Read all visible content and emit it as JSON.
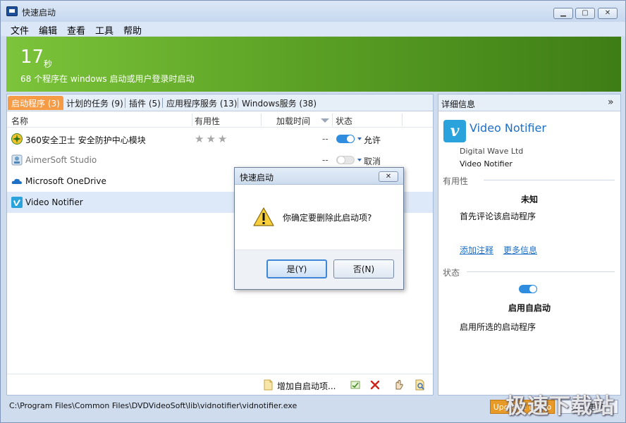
{
  "window": {
    "title": "快速启动"
  },
  "menu": [
    "文件",
    "编辑",
    "查看",
    "工具",
    "帮助"
  ],
  "banner": {
    "number": "17",
    "unit": "秒",
    "description": "68 个程序在 windows 启动或用户登录时启动"
  },
  "tabs": [
    {
      "label": "启动程序 (3)",
      "active": true
    },
    {
      "label": "计划的任务 (9)"
    },
    {
      "label": "插件 (5)"
    },
    {
      "label": "应用程序服务 (13)"
    },
    {
      "label": "Windows服务 (38)"
    }
  ],
  "columns": {
    "name": "名称",
    "usefulness": "有用性",
    "load_time": "加载时间",
    "status": "状态"
  },
  "rows": [
    {
      "name": "360安全卫士 安全防护中心模块",
      "stars": "★★★",
      "load_time": "--",
      "status": "允许",
      "enabled": true
    },
    {
      "name": "AimerSoft Studio",
      "load_time": "--",
      "status": "取消",
      "enabled": false
    },
    {
      "name": "Microsoft OneDrive"
    },
    {
      "name": "Video Notifier",
      "selected": true
    }
  ],
  "toolbar": {
    "add_label": "增加自启动项..."
  },
  "details": {
    "header": "详细信息",
    "collapse_glyph": "»",
    "logo_letter": "v",
    "app_name": "Video Notifier",
    "vendor": "Digital Wave Ltd",
    "file": "Video Notifier",
    "usefulness_section": "有用性",
    "usefulness_value": "未知",
    "rate_text": "首先评论该启动程序",
    "link_add_note": "添加注释",
    "link_more_info": "更多信息",
    "status_section": "状态",
    "status_value": "启用自启动",
    "status_desc": "启用所选的启动程序"
  },
  "statusbar": {
    "path": "C:\\Program Files\\Common Files\\DVDVideoSoft\\lib\\vidnotifier\\vidnotifier.exe",
    "upgrade": "Upgrade to Pro",
    "about": "关于更多"
  },
  "watermark": "极速下载站",
  "dialog": {
    "title": "快速启动",
    "message": "你确定要删除此启动项?",
    "yes": "是(Y)",
    "no": "否(N)"
  },
  "colors": {
    "banner_green": "#6ab52f",
    "active_tab": "#f59a45",
    "toggle_on": "#2f8de0",
    "link": "#1f6fc5",
    "upgrade": "#e89a28"
  }
}
